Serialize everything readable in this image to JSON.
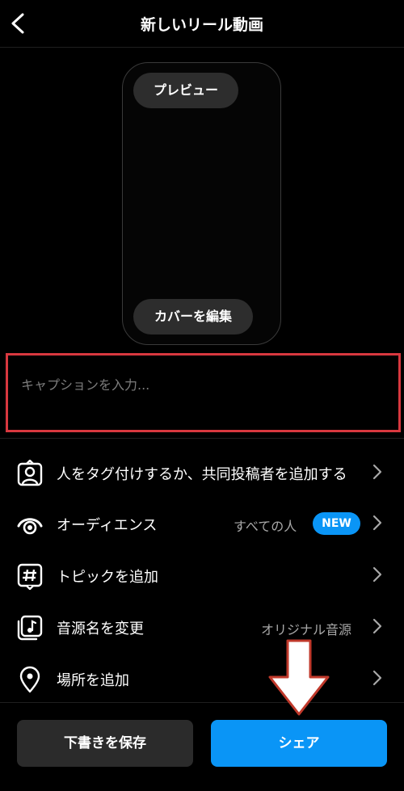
{
  "header": {
    "title": "新しいリール動画"
  },
  "preview": {
    "preview_label": "プレビュー",
    "edit_cover_label": "カバーを編集"
  },
  "caption": {
    "placeholder": "キャプションを入力..."
  },
  "menu": [
    {
      "label": "人をタグ付けするか、共同投稿者を追加する",
      "icon": "person-tag-icon"
    },
    {
      "label": "オーディエンス",
      "value": "すべての人",
      "badge": "NEW",
      "icon": "audience-icon"
    },
    {
      "label": "トピックを追加",
      "icon": "hashtag-icon"
    },
    {
      "label": "音源名を変更",
      "value": "オリジナル音源",
      "icon": "music-note-icon"
    },
    {
      "label": "場所を追加",
      "icon": "location-pin-icon"
    }
  ],
  "actions": {
    "save_draft_label": "下書きを保存",
    "share_label": "シェア"
  },
  "colors": {
    "accent": "#0a95f6",
    "highlight_border": "#d8383f",
    "annotation_arrow": "#ffffff"
  }
}
